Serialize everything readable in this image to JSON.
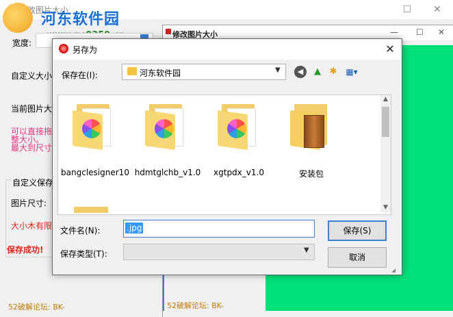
{
  "main_window": {
    "title": "修改图片大小",
    "width_label": "宽度:",
    "custom_size_label": "自定义大小",
    "current_size_label": "当前图片大",
    "hint_lines": [
      "可以直接拖",
      "整大小。",
      "最大到尺寸"
    ],
    "custom_save_label": "自定义保存",
    "image_size_label": "图片尺寸:",
    "size_limit_text": "大小木有限",
    "save_success": "保存成功!",
    "footer": "52破解论坛:  BK-",
    "maximize_glyph": "☐",
    "close_glyph": "✕"
  },
  "watermark": {
    "site_name": "河东软件园",
    "url": "www.pc0359.cn"
  },
  "second_window": {
    "title": "修改图片大小",
    "footer": "52破解论坛:  BK-",
    "minimize_glyph": "—",
    "maximize_glyph": "☐",
    "close_glyph": "✕",
    "panel_color": "#00e07a"
  },
  "dialog": {
    "title": "另存为",
    "close_glyph": "✕",
    "save_in_label": "保存在(I):",
    "save_in_value": "河东软件园",
    "files": [
      {
        "name": "bangclesigner10",
        "type": "folder"
      },
      {
        "name": "hdmtglchb_v1.0",
        "type": "folder"
      },
      {
        "name": "xgtpdx_v1.0",
        "type": "folder"
      },
      {
        "name": "安装包",
        "type": "archive-folder"
      }
    ],
    "filename_label": "文件名(N):",
    "filename_value": ".jpg",
    "filetype_label": "保存类型(T):",
    "filetype_value": "",
    "save_button": "保存(S)",
    "cancel_button": "取消"
  },
  "colors": {
    "accent_blue": "#3c7fd6",
    "hint_pink": "#f0307f",
    "warn_red": "#e0241b",
    "footer_orange": "#c07a00"
  }
}
